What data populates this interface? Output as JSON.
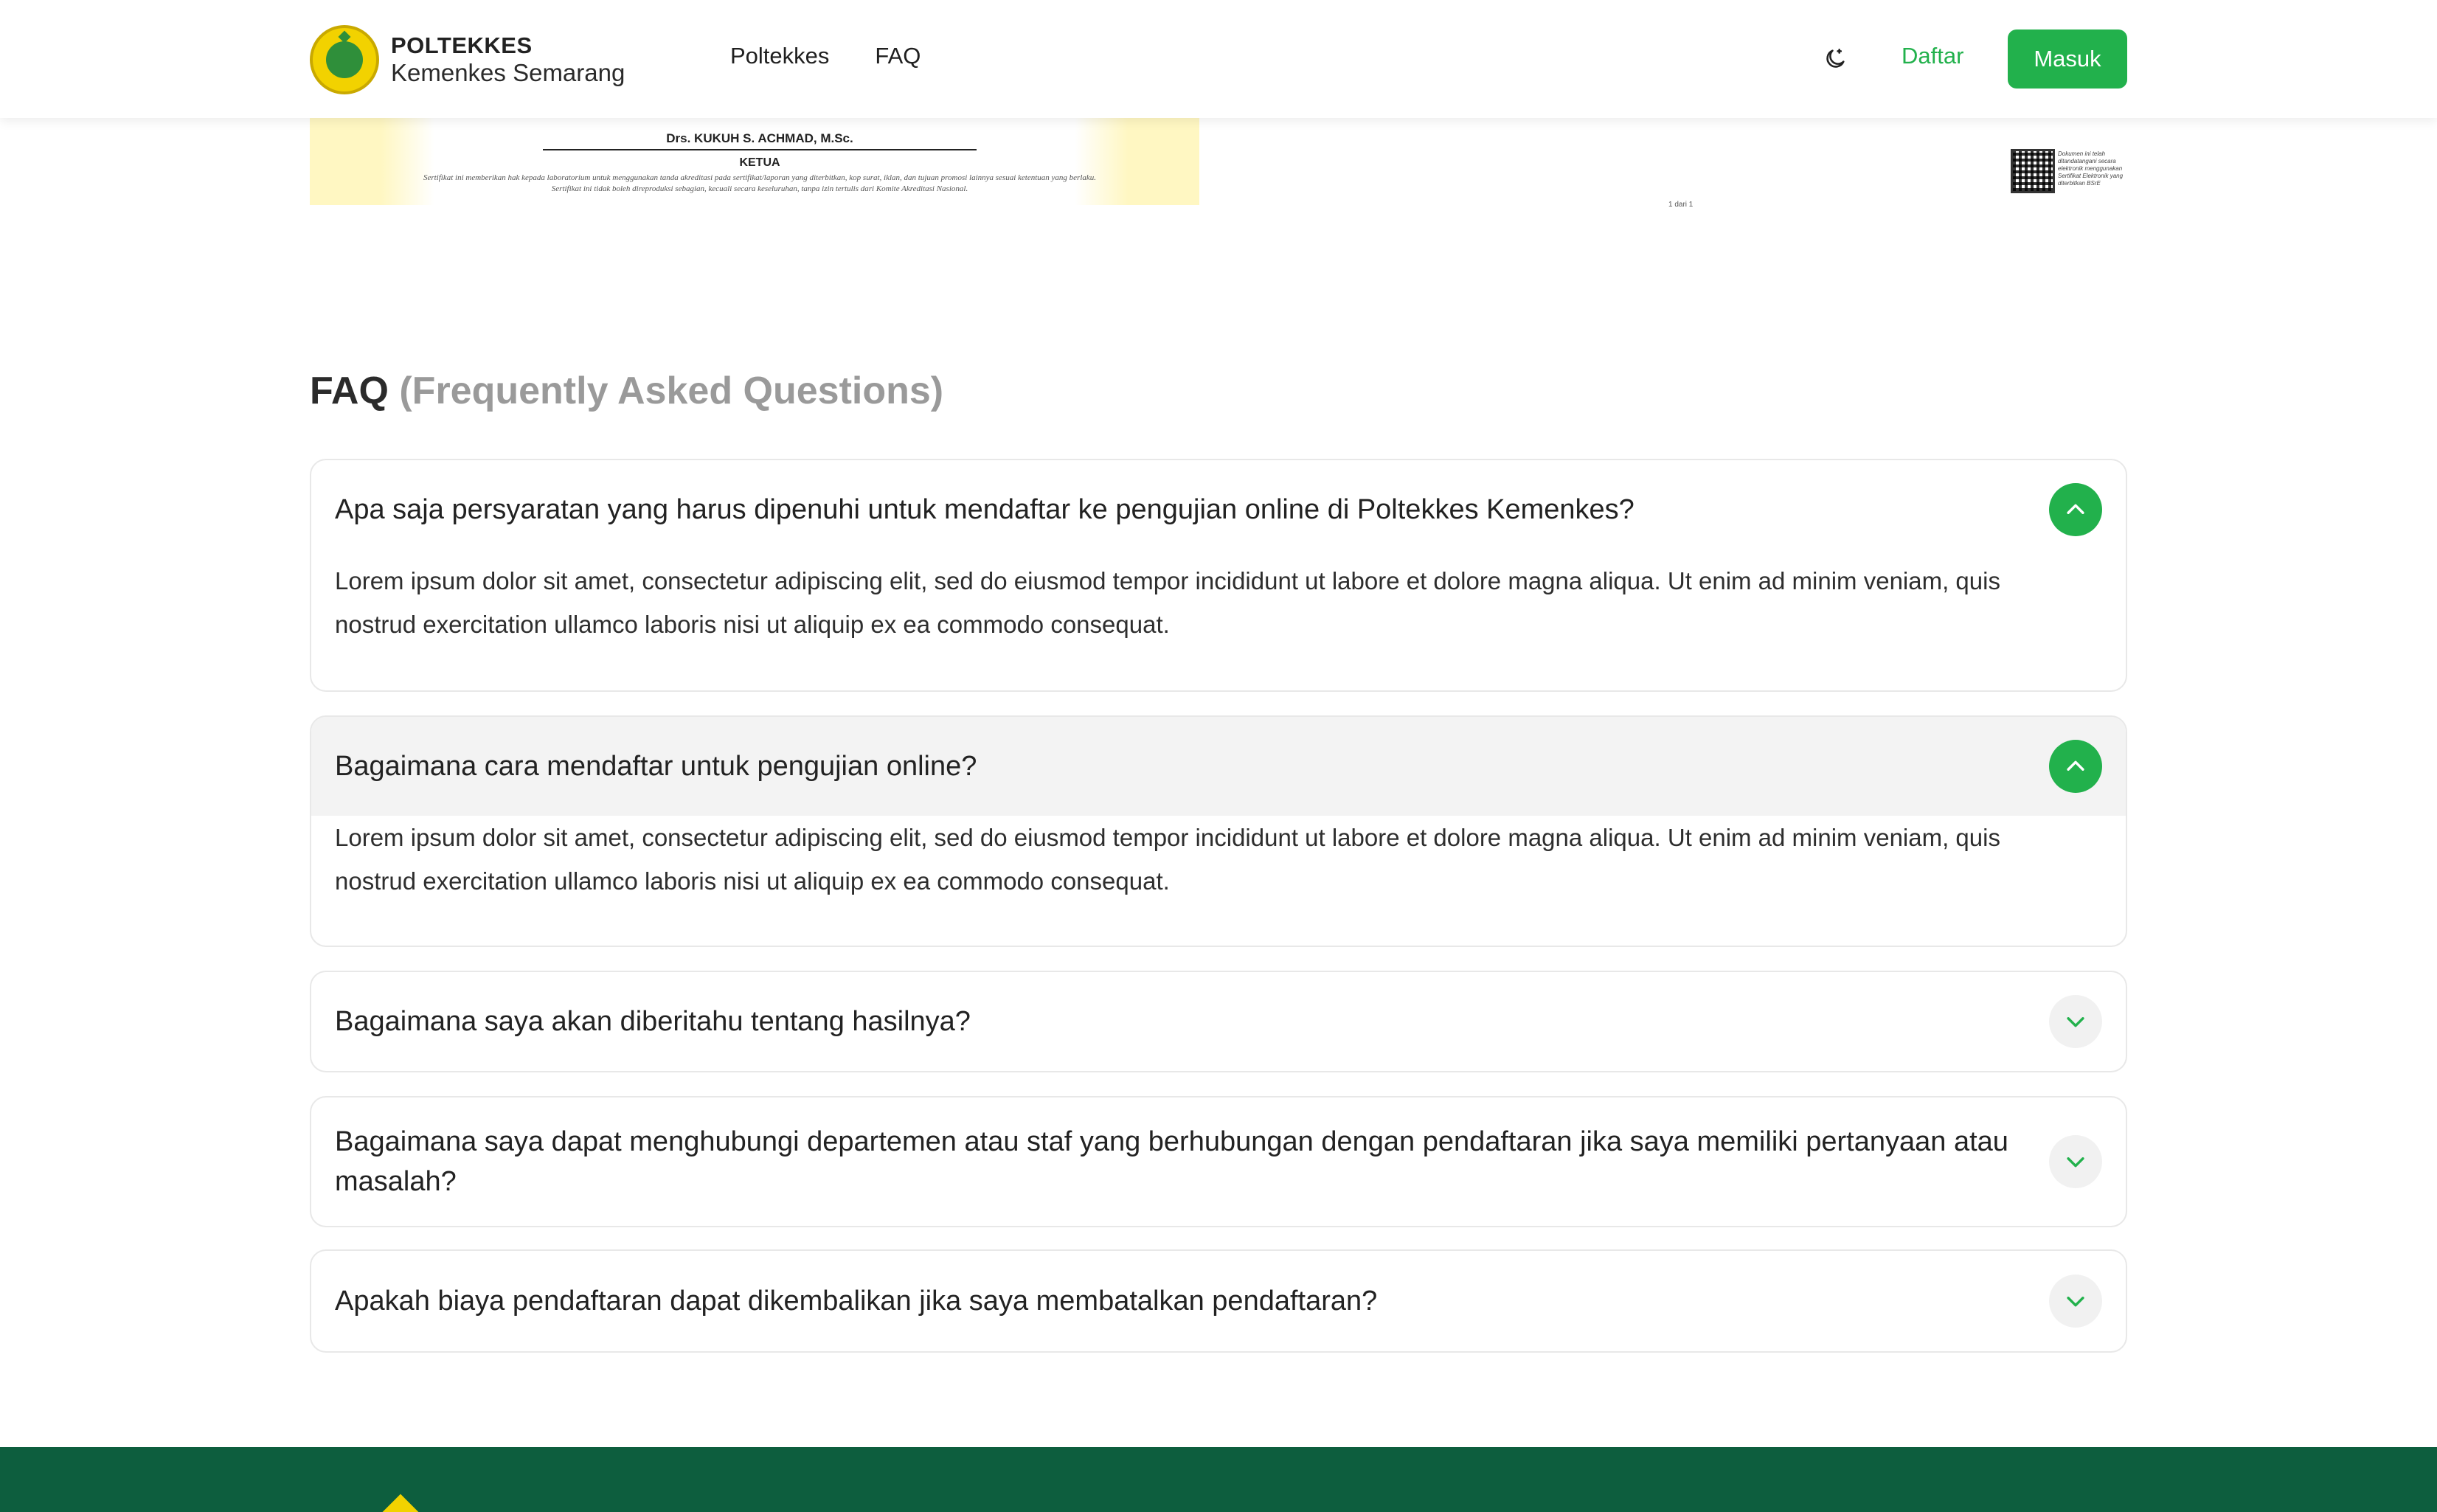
{
  "header": {
    "brand_title": "POLTEKKES",
    "brand_sub": "Kemenkes Semarang",
    "nav": [
      "Poltekkes",
      "FAQ"
    ],
    "theme_icon": "moon-icon",
    "daftar": "Daftar",
    "masuk": "Masuk"
  },
  "certificate": {
    "signer": "Drs. KUKUH S. ACHMAD, M.Sc.",
    "role": "KETUA",
    "note_line1": "Sertifikat ini memberikan hak kepada laboratorium untuk menggunakan tanda akreditasi pada sertifikat/laporan yang diterbitkan, kop surat, iklan, dan tujuan promosi lainnya sesuai ketentuan yang berlaku.",
    "note_line2": "Sertifikat ini tidak boleh direproduksi sebagian, kecuali secara keseluruhan, tanpa izin tertulis dari Komite Akreditasi Nasional.",
    "page": "1 dari 1",
    "qr_text": "Dokumen ini telah ditandatangani secara elektronik menggunakan Sertifikat Elektronik yang diterbitkan BSrE"
  },
  "faq": {
    "title": "FAQ",
    "title_muted": "(Frequently Asked Questions)",
    "items": [
      {
        "question": "Apa saja persyaratan yang harus dipenuhi untuk mendaftar ke pengujian online di Poltekkes Kemenkes?",
        "answer": "Lorem ipsum dolor sit amet, consectetur adipiscing elit, sed do eiusmod tempor incididunt ut labore et dolore magna aliqua. Ut enim ad minim veniam, quis nostrud exercitation ullamco laboris nisi ut aliquip ex ea commodo consequat.",
        "expanded": true,
        "icon": "chevron-up-icon"
      },
      {
        "question": "Bagaimana cara mendaftar untuk pengujian online?",
        "answer": "Lorem ipsum dolor sit amet, consectetur adipiscing elit, sed do eiusmod tempor incididunt ut labore et dolore magna aliqua. Ut enim ad minim veniam, quis nostrud exercitation ullamco laboris nisi ut aliquip ex ea commodo consequat.",
        "expanded": true,
        "icon": "chevron-up-icon"
      },
      {
        "question": "Bagaimana saya akan diberitahu tentang hasilnya?",
        "expanded": false,
        "icon": "chevron-down-icon"
      },
      {
        "question": "Bagaimana saya dapat menghubungi departemen atau staf yang berhubungan dengan pendaftaran jika saya memiliki pertanyaan atau masalah?",
        "expanded": false,
        "icon": "chevron-down-icon"
      },
      {
        "question": "Apakah biaya pendaftaran dapat dikembalikan jika saya membatalkan pendaftaran?",
        "expanded": false,
        "icon": "chevron-down-icon"
      }
    ]
  },
  "colors": {
    "accent": "#22b14c",
    "footer": "#0d5e3e",
    "muted_title": "#9a9a9a"
  }
}
